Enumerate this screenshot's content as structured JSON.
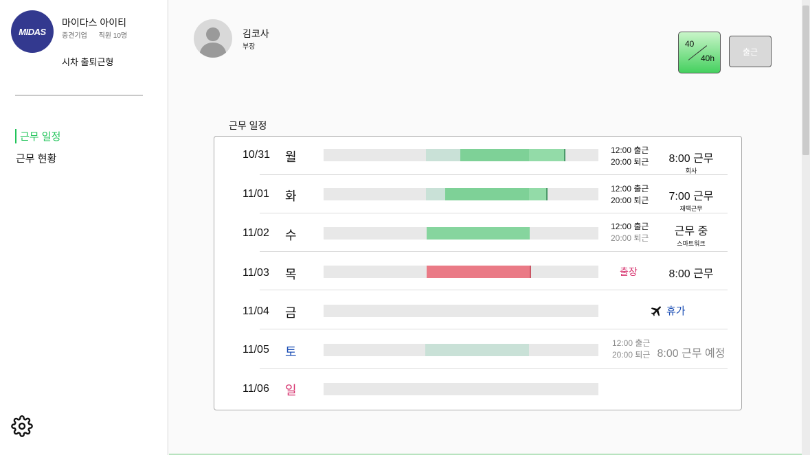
{
  "company": {
    "logo_text": "MIDAS",
    "name": "마이다스 아이티",
    "size": "중견기업",
    "employees": "직원 10명",
    "work_type": "시차 출퇴근형"
  },
  "nav": {
    "items": [
      {
        "label": "근무 일정",
        "active": true
      },
      {
        "label": "근무 현황",
        "active": false
      }
    ]
  },
  "user": {
    "name": "김코사",
    "title": "부장"
  },
  "hours": {
    "worked": "40",
    "total": "40h"
  },
  "checkin_label": "출근",
  "schedule": {
    "title": "근무 일정",
    "rows": [
      {
        "date": "10/31",
        "dow": "월",
        "checkin": "12:00 출근",
        "checkout": "20:00 퇴근",
        "status": "8:00 근무",
        "location": "회사"
      },
      {
        "date": "11/01",
        "dow": "화",
        "checkin": "12:00 출근",
        "checkout": "20:00 퇴근",
        "status": "7:00 근무",
        "location": "재택근무"
      },
      {
        "date": "11/02",
        "dow": "수",
        "checkin": "12:00 출근",
        "checkout": "20:00 퇴근",
        "status": "근무 중",
        "location": "스마트워크"
      },
      {
        "date": "11/03",
        "dow": "목",
        "trip": "출장",
        "status": "8:00 근무"
      },
      {
        "date": "11/04",
        "dow": "금",
        "vacation": "휴가"
      },
      {
        "date": "11/05",
        "dow": "토",
        "checkin": "12:00 출근",
        "checkout": "20:00 퇴근",
        "status": "8:00 근무 예정"
      },
      {
        "date": "11/06",
        "dow": "일"
      }
    ]
  },
  "colors": {
    "accent_green": "#21c45a",
    "bar_green": "#86d59e",
    "bar_green_light": "#c9e1d7",
    "bar_red": "#ea7a86",
    "saturday_blue": "#1d4fb5",
    "sunday_red": "#d6316d"
  }
}
